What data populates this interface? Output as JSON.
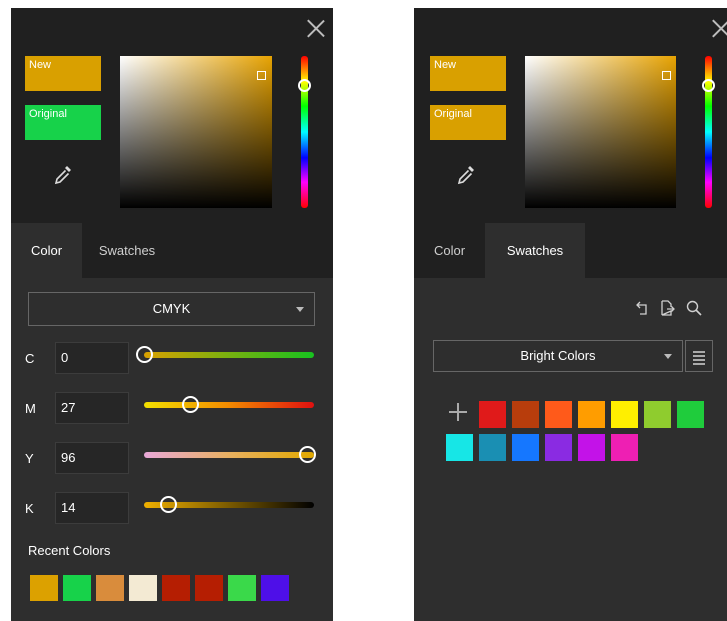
{
  "left_panel": {
    "new_label": "New",
    "original_label": "Original",
    "new_color": "#d9a000",
    "original_color": "#17d24a",
    "tabs": [
      {
        "label": "Color",
        "active": true
      },
      {
        "label": "Swatches",
        "active": false
      }
    ],
    "mode_select": {
      "value": "CMYK"
    },
    "channels": [
      {
        "label": "C",
        "value": "0"
      },
      {
        "label": "M",
        "value": "27"
      },
      {
        "label": "Y",
        "value": "96"
      },
      {
        "label": "K",
        "value": "14"
      }
    ],
    "recent_colors_title": "Recent Colors",
    "recent_colors": [
      "#dca100",
      "#17d24a",
      "#d98c3c",
      "#f3ead3",
      "#b51e02",
      "#b51e02",
      "#3ad94a",
      "#4e0fe8"
    ]
  },
  "right_panel": {
    "new_label": "New",
    "original_label": "Original",
    "tabs": [
      {
        "label": "Color",
        "active": false
      },
      {
        "label": "Swatches",
        "active": true
      }
    ],
    "toolbar_icons": [
      "load-icon",
      "export-icon",
      "search-icon"
    ],
    "swatch_set": {
      "value": "Bright Colors"
    },
    "swatches_row1": [
      "#e01a1a",
      "#b83d0c",
      "#ff5a1a",
      "#ff9d00",
      "#ffef00",
      "#8fcc2e",
      "#1fcc3c"
    ],
    "swatches_row2": [
      "#17e6e6",
      "#1a8fb3",
      "#1577ff",
      "#8a2be2",
      "#c312e8",
      "#ee1fb3"
    ]
  }
}
